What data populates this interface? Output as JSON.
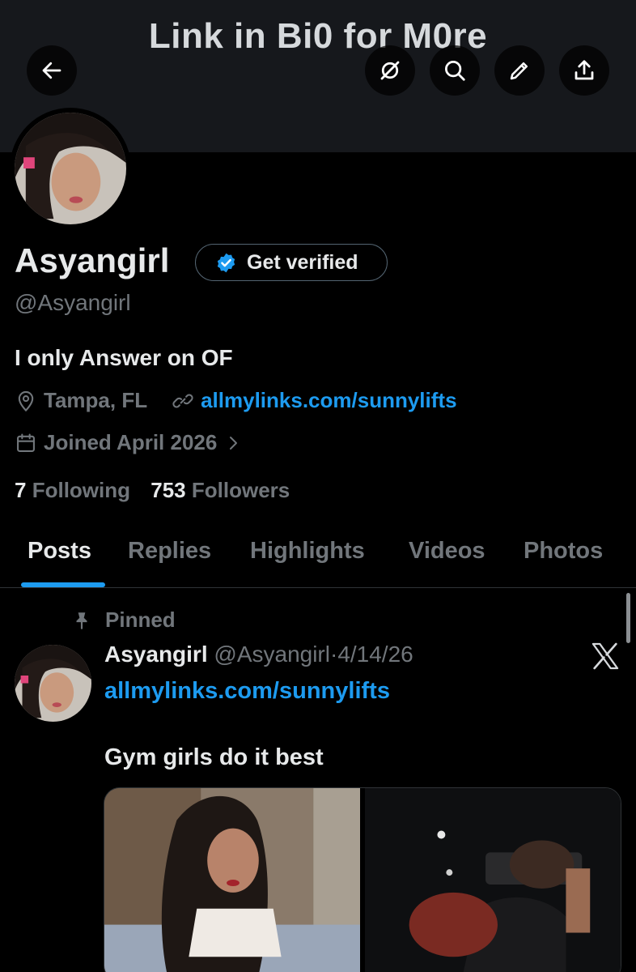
{
  "banner": {
    "title": "Link in Bi0 for M0re"
  },
  "header_buttons": {
    "back": "back-arrow-icon",
    "grok": "grok-icon",
    "search": "search-icon",
    "edit": "pencil-icon",
    "share": "share-icon"
  },
  "profile": {
    "name": "Asyangirl",
    "verify_label": "Get verified",
    "handle": "@Asyangirl",
    "bio": "I only Answer on OF",
    "location": "Tampa, FL",
    "website": "allmylinks.com/sunnylifts",
    "joined": "Joined April 2026",
    "following_count": "7",
    "following_label": "Following",
    "followers_count": "753",
    "followers_label": "Followers"
  },
  "tabs": [
    {
      "label": "Posts",
      "active": true
    },
    {
      "label": "Replies",
      "active": false
    },
    {
      "label": "Highlights",
      "active": false
    },
    {
      "label": "Videos",
      "active": false
    },
    {
      "label": "Photos",
      "active": false
    }
  ],
  "pinned_post": {
    "pinned_label": "Pinned",
    "author": "Asyangirl",
    "handle": "@Asyangirl",
    "separator": "·",
    "date": "4/14/26",
    "link": "allmylinks.com/sunnylifts",
    "text": "Gym girls do it best"
  },
  "colors": {
    "accent": "#1d9bf0",
    "background": "#000000",
    "banner": "#16181c",
    "secondary_text": "#71767b",
    "primary_text": "#e7e9ea"
  }
}
